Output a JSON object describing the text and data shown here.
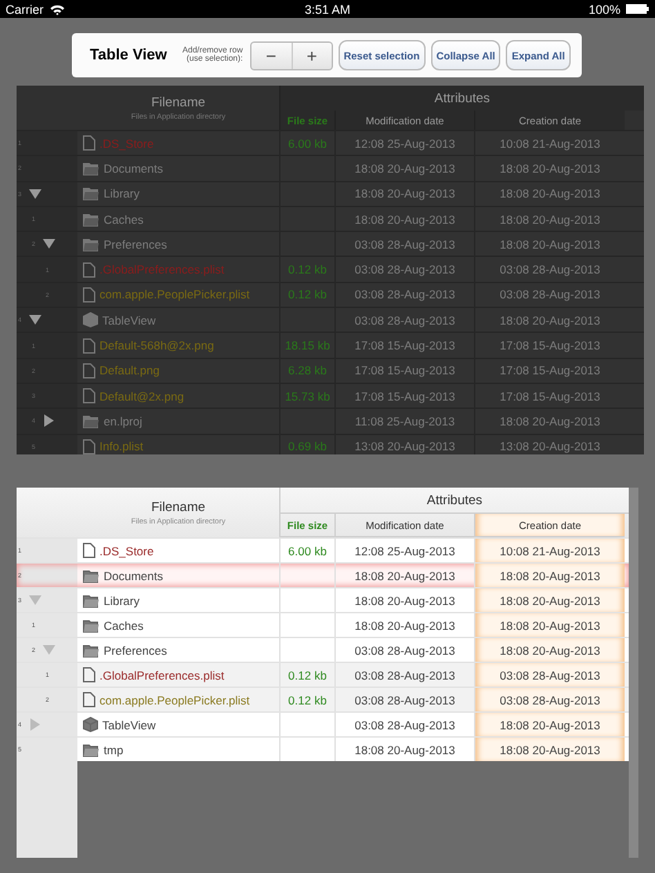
{
  "status_bar": {
    "carrier": "Carrier",
    "time": "3:51 AM",
    "battery": "100%"
  },
  "toolbar": {
    "title": "Table View",
    "hint_lines": [
      "Add/remove row",
      "(use selection):"
    ],
    "stepper": [
      "−",
      "+"
    ],
    "buttons": [
      "Reset selection",
      "Collapse All",
      "Expand All"
    ]
  },
  "tables": [
    {
      "kind": "dark",
      "filename_header": "Filename",
      "filename_subtitle": "Files in Application directory",
      "group_header": "Attributes",
      "columns": [
        {
          "label": "File size",
          "selected": false
        },
        {
          "label": "Modification date",
          "selected": false
        },
        {
          "label": "Creation date",
          "selected": false
        }
      ],
      "rows": [
        {
          "index": "1",
          "name": ".DS_Store",
          "kind": "file",
          "color": "#8c1c1c",
          "size": "6.00 kb",
          "modified": "12:08  25-Aug-2013",
          "created": "10:08  21-Aug-2013",
          "selected": false
        },
        {
          "index": "2",
          "name": "Documents",
          "kind": "folder",
          "modified": "18:08  20-Aug-2013",
          "created": "18:08  20-Aug-2013",
          "selected": false
        },
        {
          "index": "3",
          "name": "Library",
          "kind": "folder",
          "expanded": true,
          "modified": "18:08  20-Aug-2013",
          "created": "18:08  20-Aug-2013",
          "selected": false,
          "children": [
            {
              "index": "1",
              "name": "Caches",
              "kind": "folder",
              "modified": "18:08  20-Aug-2013",
              "created": "18:08  20-Aug-2013",
              "selected": false
            },
            {
              "index": "2",
              "name": "Preferences",
              "kind": "folder",
              "expanded": true,
              "modified": "03:08  28-Aug-2013",
              "created": "18:08  20-Aug-2013",
              "selected": false,
              "children": [
                {
                  "index": "1",
                  "name": ".GlobalPreferences.plist",
                  "kind": "file",
                  "color": "#8c1c1c",
                  "size": "0.12 kb",
                  "modified": "03:08  28-Aug-2013",
                  "created": "03:08  28-Aug-2013",
                  "selected": false
                },
                {
                  "index": "2",
                  "name": "com.apple.PeoplePicker.plist",
                  "kind": "file",
                  "color": "#7a6a12",
                  "size": "0.12 kb",
                  "modified": "03:08  28-Aug-2013",
                  "created": "03:08  28-Aug-2013",
                  "selected": false
                }
              ]
            }
          ]
        },
        {
          "index": "4",
          "name": "TableView",
          "kind": "app",
          "expanded": true,
          "modified": "03:08  28-Aug-2013",
          "created": "18:08  20-Aug-2013",
          "selected": false,
          "children": [
            {
              "index": "1",
              "name": "Default-568h@2x.png",
              "kind": "file",
              "color": "#7a6a12",
              "size": "18.15 kb",
              "modified": "17:08  15-Aug-2013",
              "created": "17:08  15-Aug-2013",
              "selected": false
            },
            {
              "index": "2",
              "name": "Default.png",
              "kind": "file",
              "color": "#7a6a12",
              "size": "6.28 kb",
              "modified": "17:08  15-Aug-2013",
              "created": "17:08  15-Aug-2013",
              "selected": false
            },
            {
              "index": "3",
              "name": "Default@2x.png",
              "kind": "file",
              "color": "#7a6a12",
              "size": "15.73 kb",
              "modified": "17:08  15-Aug-2013",
              "created": "17:08  15-Aug-2013",
              "selected": false
            },
            {
              "index": "4",
              "name": "en.lproj",
              "kind": "folder",
              "expanded": false,
              "modified": "11:08  25-Aug-2013",
              "created": "18:08  20-Aug-2013",
              "selected": false
            },
            {
              "index": "5",
              "name": "Info.plist",
              "kind": "file",
              "color": "#7a6a12",
              "size": "0.69 kb",
              "modified": "13:08  20-Aug-2013",
              "created": "13:08  20-Aug-2013",
              "selected": false
            }
          ]
        }
      ]
    },
    {
      "kind": "light",
      "filename_header": "Filename",
      "filename_subtitle": "Files in Application directory",
      "group_header": "Attributes",
      "columns": [
        {
          "label": "File size",
          "selected": false
        },
        {
          "label": "Modification date",
          "selected": false
        },
        {
          "label": "Creation date",
          "selected": true
        }
      ],
      "rows": [
        {
          "index": "1",
          "name": ".DS_Store",
          "kind": "file",
          "color": "#9a2a2a",
          "size": "6.00 kb",
          "modified": "12:08  25-Aug-2013",
          "created": "10:08  21-Aug-2013",
          "selected": false
        },
        {
          "index": "2",
          "name": "Documents",
          "kind": "folder",
          "modified": "18:08  20-Aug-2013",
          "created": "18:08  20-Aug-2013",
          "selected": true
        },
        {
          "index": "3",
          "name": "Library",
          "kind": "folder",
          "expanded": true,
          "modified": "18:08  20-Aug-2013",
          "created": "18:08  20-Aug-2013",
          "selected": false,
          "children": [
            {
              "index": "1",
              "name": "Caches",
              "kind": "folder",
              "modified": "18:08  20-Aug-2013",
              "created": "18:08  20-Aug-2013",
              "selected": false
            },
            {
              "index": "2",
              "name": "Preferences",
              "kind": "folder",
              "expanded": true,
              "modified": "03:08  28-Aug-2013",
              "created": "18:08  20-Aug-2013",
              "selected": false,
              "children": [
                {
                  "index": "1",
                  "name": ".GlobalPreferences.plist",
                  "kind": "file",
                  "color": "#9a2a2a",
                  "size": "0.12 kb",
                  "modified": "03:08  28-Aug-2013",
                  "created": "03:08  28-Aug-2013",
                  "selected": false
                },
                {
                  "index": "2",
                  "name": "com.apple.PeoplePicker.plist",
                  "kind": "file",
                  "color": "#8a7a20",
                  "size": "0.12 kb",
                  "modified": "03:08  28-Aug-2013",
                  "created": "03:08  28-Aug-2013",
                  "selected": false
                }
              ]
            }
          ]
        },
        {
          "index": "4",
          "name": "TableView",
          "kind": "app",
          "expanded": false,
          "modified": "03:08  28-Aug-2013",
          "created": "18:08  20-Aug-2013",
          "selected": false
        },
        {
          "index": "5",
          "name": "tmp",
          "kind": "folder",
          "modified": "18:08  20-Aug-2013",
          "created": "18:08  20-Aug-2013",
          "selected": false
        }
      ]
    }
  ]
}
